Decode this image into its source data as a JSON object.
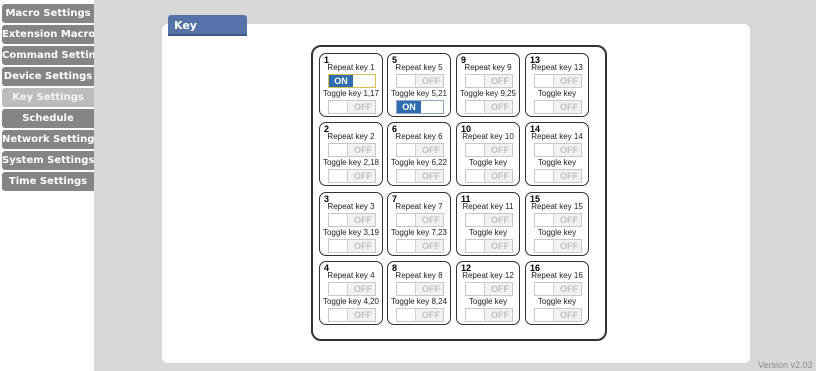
{
  "sidebar": {
    "items": [
      {
        "label": "Macro Settings",
        "active": false
      },
      {
        "label": "Extension Macro",
        "active": false
      },
      {
        "label": "Command Settings",
        "active": false
      },
      {
        "label": "Device Settings",
        "active": false
      },
      {
        "label": "Key Settings",
        "active": true
      },
      {
        "label": "Schedule",
        "active": false
      },
      {
        "label": "Network Settings",
        "active": false
      },
      {
        "label": "System Settings",
        "active": false
      },
      {
        "label": "Time Settings",
        "active": false
      }
    ]
  },
  "panel": {
    "title": "Key Settings"
  },
  "keys": [
    {
      "num": "1",
      "repeat_label": "Repeat key 1",
      "repeat_state": "ON",
      "toggle_label": "Toggle key 1,17",
      "toggle_state": "OFF"
    },
    {
      "num": "5",
      "repeat_label": "Repeat key 5",
      "repeat_state": "OFF",
      "toggle_label": "Toggle key 5,21",
      "toggle_state": "ON"
    },
    {
      "num": "9",
      "repeat_label": "Repeat key 9",
      "repeat_state": "OFF",
      "toggle_label": "Toggle key 9,25",
      "toggle_state": "OFF"
    },
    {
      "num": "13",
      "repeat_label": "Repeat key 13",
      "repeat_state": "OFF",
      "toggle_label": "Toggle key",
      "toggle_state": "OFF"
    },
    {
      "num": "2",
      "repeat_label": "Repeat key 2",
      "repeat_state": "OFF",
      "toggle_label": "Toggle key 2,18",
      "toggle_state": "OFF"
    },
    {
      "num": "6",
      "repeat_label": "Repeat key 6",
      "repeat_state": "OFF",
      "toggle_label": "Toggle key 6,22",
      "toggle_state": "OFF"
    },
    {
      "num": "10",
      "repeat_label": "Repeat key 10",
      "repeat_state": "OFF",
      "toggle_label": "Toggle key",
      "toggle_state": "OFF"
    },
    {
      "num": "14",
      "repeat_label": "Repeat key 14",
      "repeat_state": "OFF",
      "toggle_label": "Toggle key",
      "toggle_state": "OFF"
    },
    {
      "num": "3",
      "repeat_label": "Repeat key 3",
      "repeat_state": "OFF",
      "toggle_label": "Toggle key 3,19",
      "toggle_state": "OFF"
    },
    {
      "num": "7",
      "repeat_label": "Repeat key 7",
      "repeat_state": "OFF",
      "toggle_label": "Toggle key 7,23",
      "toggle_state": "OFF"
    },
    {
      "num": "11",
      "repeat_label": "Repeat key 11",
      "repeat_state": "OFF",
      "toggle_label": "Toggle key",
      "toggle_state": "OFF"
    },
    {
      "num": "15",
      "repeat_label": "Repeat key 15",
      "repeat_state": "OFF",
      "toggle_label": "Toggle key",
      "toggle_state": "OFF"
    },
    {
      "num": "4",
      "repeat_label": "Repeat key 4",
      "repeat_state": "OFF",
      "toggle_label": "Toggle key 4,20",
      "toggle_state": "OFF"
    },
    {
      "num": "8",
      "repeat_label": "Repeat key 8",
      "repeat_state": "OFF",
      "toggle_label": "Toggle key 8,24",
      "toggle_state": "OFF"
    },
    {
      "num": "12",
      "repeat_label": "Repeat key 12",
      "repeat_state": "OFF",
      "toggle_label": "Toggle key",
      "toggle_state": "OFF"
    },
    {
      "num": "16",
      "repeat_label": "Repeat key 16",
      "repeat_state": "OFF",
      "toggle_label": "Toggle key",
      "toggle_state": "OFF"
    }
  ],
  "version": "Version v2.03",
  "colors": {
    "nav_bg": "#858585",
    "nav_active_bg": "#bcbcbc",
    "title_bg": "#5573a8",
    "toggle_on": "#2f6db0"
  }
}
